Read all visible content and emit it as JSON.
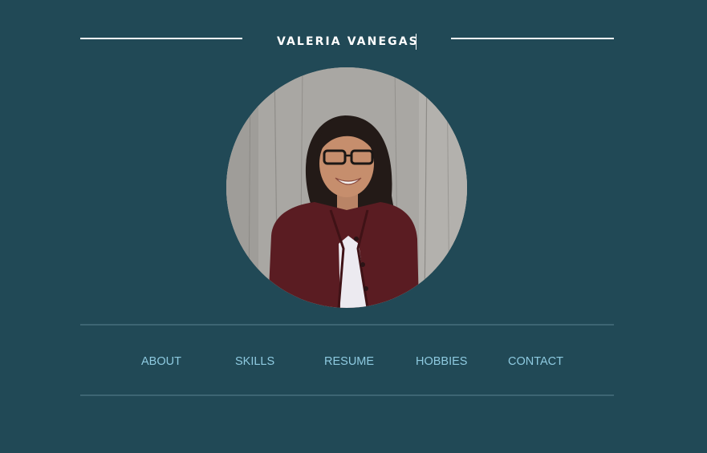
{
  "header": {
    "name": "VALERIA VANEGAS"
  },
  "profile_photo": {
    "description_icon": "profile-photo"
  },
  "nav": {
    "items": [
      {
        "label": "ABOUT"
      },
      {
        "label": "SKILLS"
      },
      {
        "label": "RESUME"
      },
      {
        "label": "HOBBIES"
      },
      {
        "label": "CONTACT"
      }
    ]
  },
  "colors": {
    "background": "#214956",
    "nav_text": "#8ecae0",
    "divider": "#3d6573",
    "title": "#ffffff"
  }
}
